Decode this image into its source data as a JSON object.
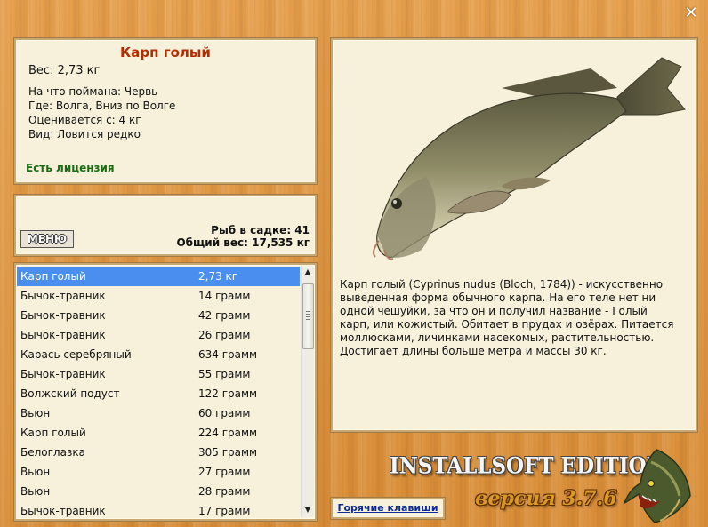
{
  "info": {
    "title": "Карп голый",
    "weight": "Вес: 2,73 кг",
    "caught_on": "На что поймана: Червь",
    "location": "Где: Волга, Вниз по Волге",
    "valued_from": "Оценивается с: 4 кг",
    "kind": "Вид: Ловится редко",
    "license": "Есть лицензия"
  },
  "cage": {
    "menu_label": "МЕНЮ",
    "fish_count": "Рыб в садке: 41",
    "total_weight": "Общий вес: 17,535 кг"
  },
  "catch_list": [
    {
      "name": "Карп голый",
      "weight": "2,73 кг",
      "selected": true
    },
    {
      "name": "Бычок-травник",
      "weight": "14 грамм"
    },
    {
      "name": "Бычок-травник",
      "weight": "42 грамм"
    },
    {
      "name": "Бычок-травник",
      "weight": "26 грамм"
    },
    {
      "name": "Карась серебряный",
      "weight": "634 грамм"
    },
    {
      "name": "Бычок-травник",
      "weight": "55 грамм"
    },
    {
      "name": "Волжский подуст",
      "weight": "122 грамм"
    },
    {
      "name": "Вьюн",
      "weight": "60 грамм"
    },
    {
      "name": "Карп голый",
      "weight": "224 грамм"
    },
    {
      "name": "Белоглазка",
      "weight": "305 грамм"
    },
    {
      "name": "Вьюн",
      "weight": "27 грамм"
    },
    {
      "name": "Вьюн",
      "weight": "28 грамм"
    },
    {
      "name": "Бычок-травник",
      "weight": "17 грамм"
    }
  ],
  "description": "Карп голый (Cyprinus nudus (Bloch, 1784)) - искусственно выведенная форма обычного карпа. На его теле нет ни одной чешуйки, за что он и получил название - Голый карп, или кожистый. Обитает в прудах и озёрах. Питается моллюсками, личинками насекомых, растительностью. Достигает длины больше метра и массы 30 кг.",
  "footer": {
    "hotkeys": "Горячие клавиши",
    "brand": "INSTALLSOFT EDITION",
    "version": "версия 3.7.6"
  },
  "window": {
    "close_glyph": "✕"
  },
  "colors": {
    "title": "#b22d00",
    "license": "#1a6b0f",
    "selection": "#4a8ff0",
    "panel_bg": "#f7f1dc",
    "link": "#0a2a9a"
  }
}
